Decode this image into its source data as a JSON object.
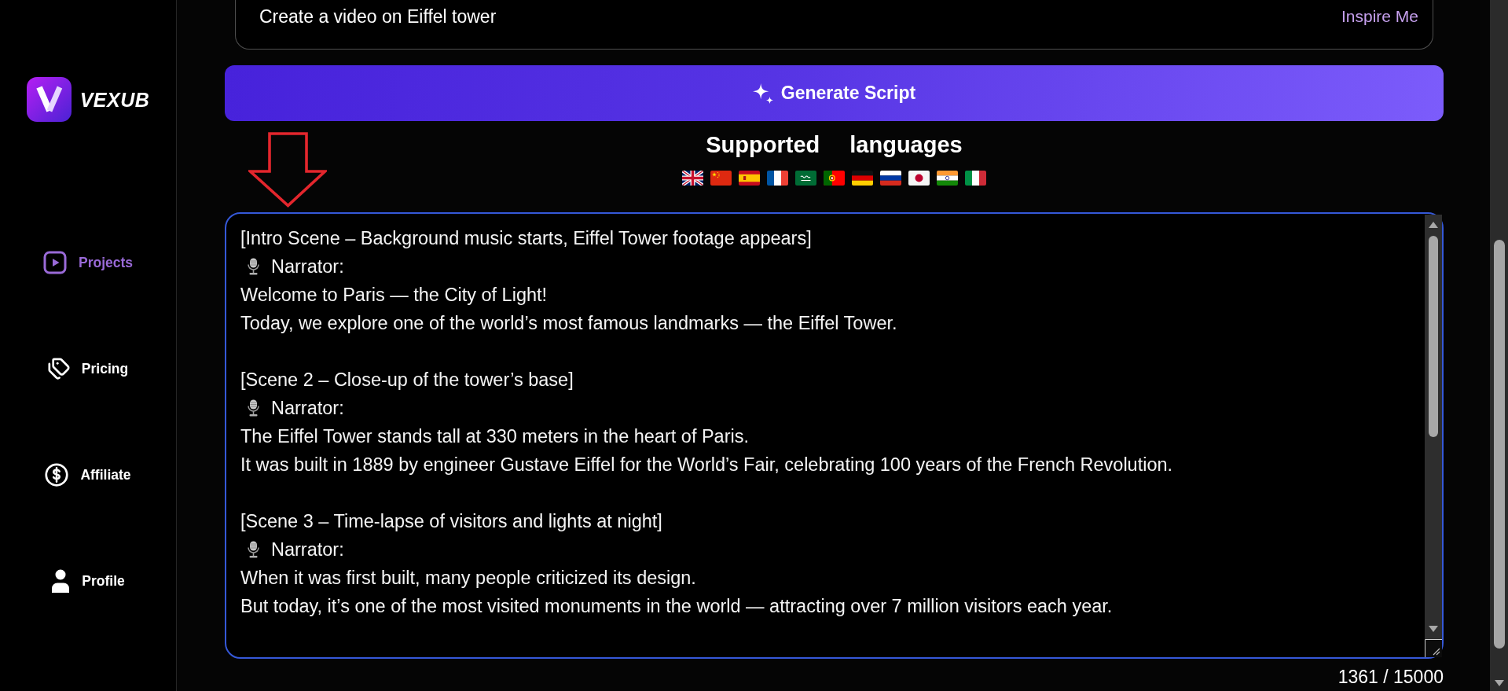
{
  "sidebar": {
    "logo": {
      "name": "VEXUB"
    },
    "nav": [
      {
        "label": "Projects",
        "selected": true
      },
      {
        "label": "Pricing",
        "selected": false
      },
      {
        "label": "Affiliate",
        "selected": false
      },
      {
        "label": "Profile",
        "selected": false
      }
    ]
  },
  "prompt": {
    "value": "Create a video on Eiffel tower",
    "inspire_link": "Inspire Me"
  },
  "generate_button": {
    "label": "Generate Script"
  },
  "languages": {
    "title": "Supported languages"
  },
  "script": {
    "scenes": [
      {
        "heading": "[Intro Scene – Background music starts, Eiffel Tower footage appears]",
        "speaker": "Narrator:",
        "lines": [
          "Welcome to Paris — the City of Light!",
          "Today, we explore one of the world’s most famous landmarks — the Eiffel Tower."
        ]
      },
      {
        "heading": "[Scene 2 – Close-up of the tower’s base]",
        "speaker": "Narrator:",
        "lines": [
          "The Eiffel Tower stands tall at 330 meters in the heart of Paris.",
          "It was built in 1889 by engineer Gustave Eiffel for the World’s Fair, celebrating 100 years of the French Revolution."
        ]
      },
      {
        "heading": "[Scene 3 – Time-lapse of visitors and lights at night]",
        "speaker": "Narrator:",
        "lines": [
          "When it was first built, many people criticized its design.",
          "But today, it’s one of the most visited monuments in the world — attracting over 7 million visitors each year."
        ]
      }
    ]
  },
  "counter": "1361 / 15000"
}
